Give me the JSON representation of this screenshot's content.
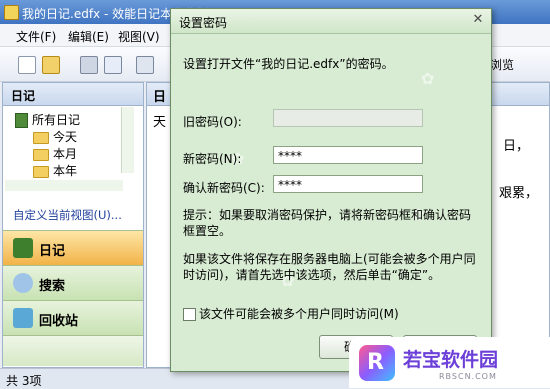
{
  "window": {
    "title": "我的日记.edfx - 效能日记本专业版 - 日记"
  },
  "menu": [
    "文件(F)",
    "编辑(E)",
    "视图(V)"
  ],
  "toolbar": {
    "browse_label": "浏览"
  },
  "left_pane": {
    "title": "日记",
    "tree": {
      "root": "所有日记",
      "children": [
        "今天",
        "本月",
        "本年"
      ]
    },
    "custom_view": "自定义当前视图(U)...",
    "nav_buttons": [
      "日记",
      "搜索",
      "回收站"
    ]
  },
  "right_pane": {
    "header": "日",
    "column_header_fragment": "天",
    "snippets": [
      "日，",
      "艰累，"
    ]
  },
  "status": {
    "text": "共 3项"
  },
  "dialog": {
    "title": "设置密码",
    "instruction": "设置打开文件“我的日记.edfx”的密码。",
    "old_password_label": "旧密码(O):",
    "new_password_label": "新密码(N):",
    "confirm_password_label": "确认新密码(C):",
    "new_password_value": "****",
    "confirm_password_value": "****",
    "hint": "提示：如果要取消密码保护，请将新密码框和确认密码框置空。",
    "note": "如果该文件将保存在服务器电脑上(可能会被多个用户同时访问)，请首先选中该选项，然后单击“确定”。",
    "checkbox_label": "该文件可能会被多个用户同时访问(M)",
    "checkbox_checked": false,
    "ok_label": "确定",
    "cancel_label": "取消"
  },
  "watermark": {
    "name": "若宝软件园",
    "url": "RBSCN.COM",
    "logo_letter": "R"
  }
}
